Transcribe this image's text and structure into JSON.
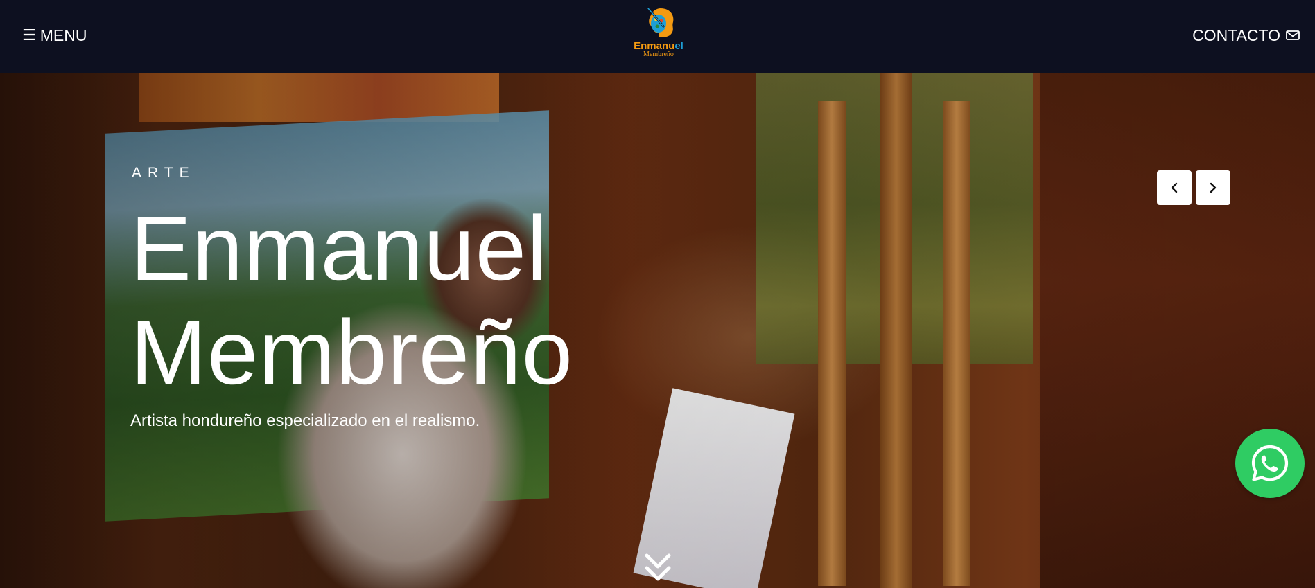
{
  "header": {
    "menu_label": "MENU",
    "menu_icon": "☰",
    "logo": {
      "name_main": "Enmanu",
      "name_accent": "el",
      "sub": "Membreño",
      "icon": "palette-head-icon"
    },
    "contact_label": "CONTACTO",
    "contact_icon": "mail-icon"
  },
  "hero": {
    "eyebrow": "ARTE",
    "title_line1": "Enmanuel",
    "title_line2": "Membreño",
    "subtitle": "Artista hondureño especializado en el realismo.",
    "prev_icon": "chevron-left-icon",
    "next_icon": "chevron-right-icon",
    "scroll_icon": "double-chevron-down-icon"
  },
  "whatsapp": {
    "icon": "whatsapp-icon",
    "color": "#2fcc63"
  },
  "colors": {
    "header_bg": "#0d1020",
    "logo_orange": "#f39a12",
    "logo_blue": "#1e9fd6"
  }
}
